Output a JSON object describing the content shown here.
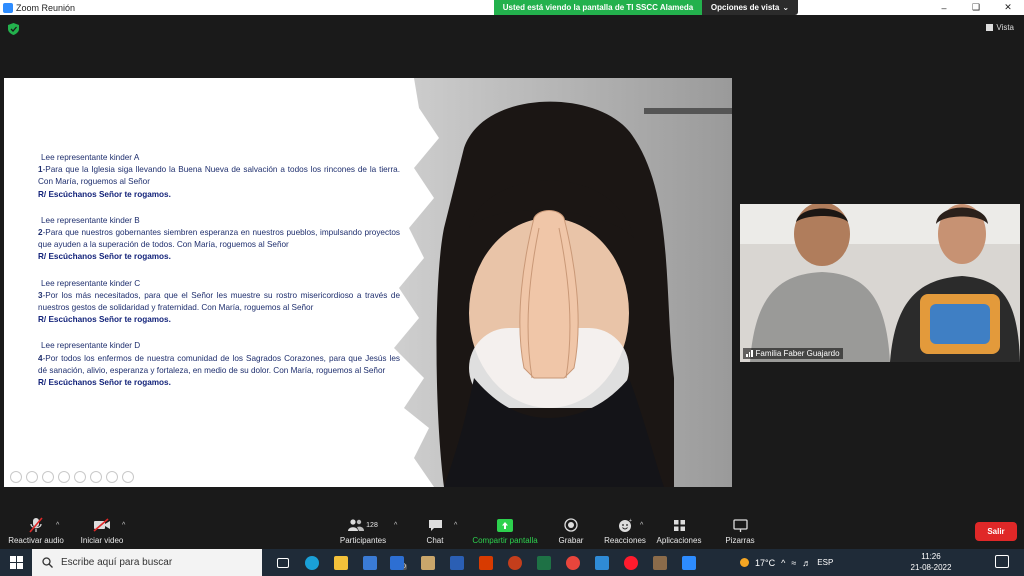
{
  "window": {
    "title": "Zoom Reunión",
    "share_banner": "Usted está viendo la pantalla de TI SSCC Alameda",
    "view_options": "Opciones de vista",
    "view_options_chevron": "chevron-down-icon",
    "vista_label": "Vista"
  },
  "slide": {
    "blocks": [
      {
        "reader": "Lee representante kinder A",
        "number": "1",
        "petition": "Para que la Iglesia siga llevando la Buena Nueva de salvación a todos los rincones de la tierra. Con María, roguemos al Señor",
        "response": "R/ Escúchanos Señor te rogamos."
      },
      {
        "reader": "Lee representante kinder B",
        "number": "2",
        "petition": "Para que nuestros gobernantes siembren esperanza en nuestros pueblos, impulsando proyectos que ayuden a la superación de todos. Con María, roguemos al Señor",
        "response": "R/ Escúchanos Señor te rogamos."
      },
      {
        "reader": "Lee representante kinder C",
        "number": "3",
        "petition": "Por los más necesitados, para que el Señor les muestre su rostro misericordioso a través de nuestros gestos de solidaridad y fraternidad. Con María, roguemos al Señor",
        "response": "R/ Escúchanos Señor te rogamos."
      },
      {
        "reader": "Lee representante kinder D",
        "number": "4",
        "petition": "Por todos los enfermos de nuestra comunidad de los Sagrados Corazones, para que Jesús les dé sanación, alivio, esperanza y fortaleza, en medio de su dolor. Con María, roguemos al Señor",
        "response": "R/ Escúchanos Señor te rogamos."
      }
    ]
  },
  "video_tile": {
    "participant_name": "Familia Faber Guajardo"
  },
  "toolbar": {
    "audio": "Reactivar audio",
    "video": "Iniciar video",
    "participants": "Participantes",
    "participants_count": "128",
    "chat": "Chat",
    "share": "Compartir pantalla",
    "record": "Grabar",
    "reactions": "Reacciones",
    "apps": "Aplicaciones",
    "whiteboards": "Pizarras",
    "leave": "Salir"
  },
  "taskbar": {
    "search_placeholder": "Escribe aquí para buscar",
    "mail_badge": "40",
    "weather": "17°C",
    "language": "ESP",
    "time": "11:26",
    "date": "21-08-2022"
  },
  "colors": {
    "share_green": "#23b14d",
    "leave_red": "#e02828",
    "slide_text": "#1f2f6e",
    "taskbar": "#1f2b38"
  }
}
